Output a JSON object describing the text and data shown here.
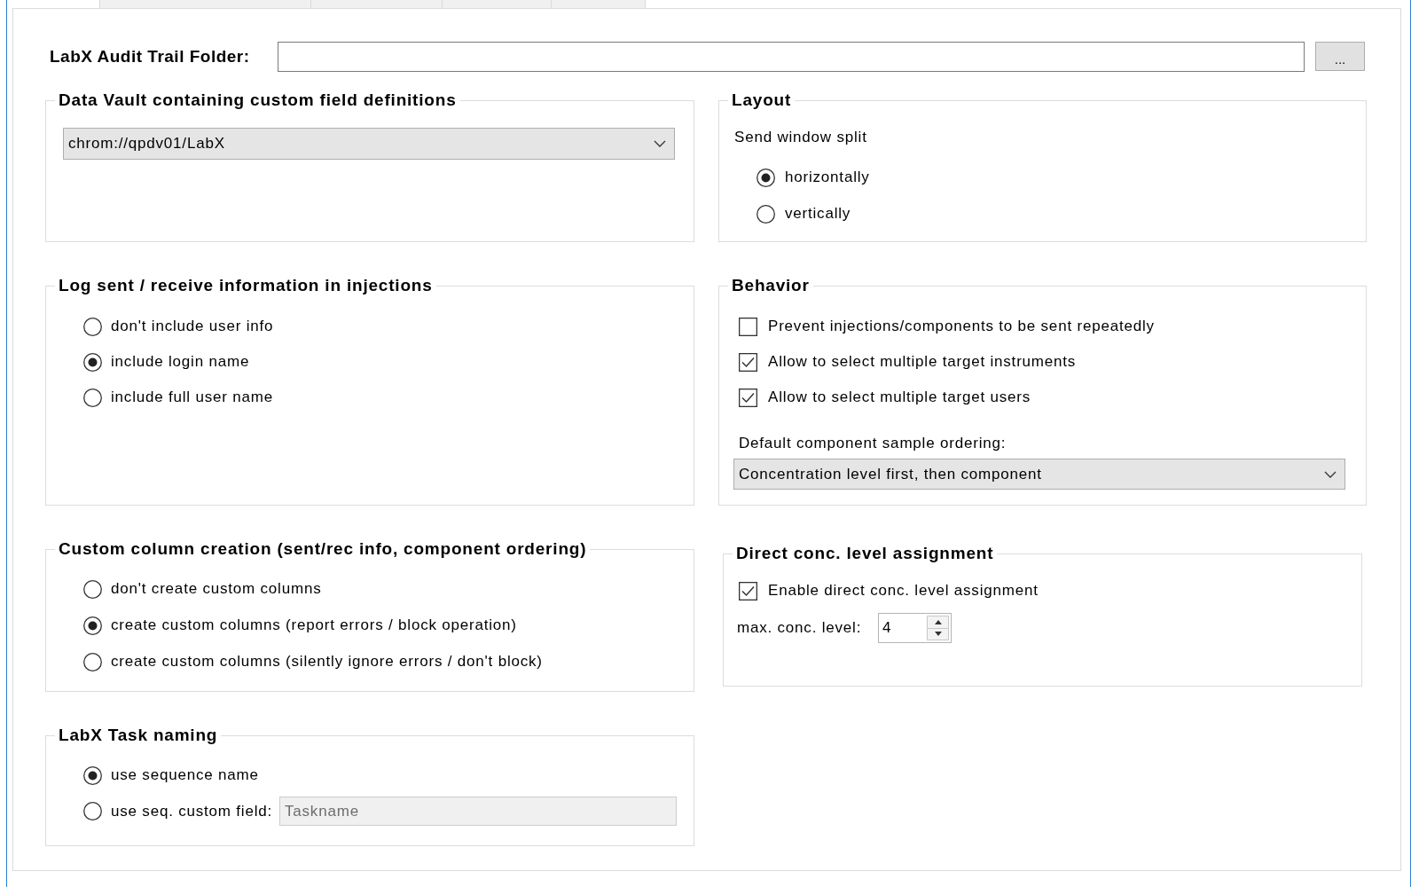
{
  "tabs": [
    {
      "selected": false
    },
    {
      "selected": false
    },
    {
      "selected": false
    },
    {
      "selected": false
    }
  ],
  "audit_folder": {
    "label": "LabX Audit Trail Folder:",
    "button": "..."
  },
  "data_vault": {
    "title": "Data Vault containing custom field definitions",
    "dropdown": {
      "value": "chrom://qpdv01/LabX"
    }
  },
  "layout": {
    "title": "Layout",
    "label": "Send window split",
    "options": [
      {
        "label": "horizontally",
        "selected": true
      },
      {
        "label": "vertically",
        "selected": false
      }
    ]
  },
  "log_info": {
    "title": "Log sent / receive information in injections",
    "options": [
      {
        "label": "don't include user info",
        "selected": false
      },
      {
        "label": "include login name",
        "selected": true
      },
      {
        "label": "include full user name",
        "selected": false
      }
    ]
  },
  "behavior": {
    "title": "Behavior",
    "checkboxes": [
      {
        "label": "Prevent injections/components to be sent repeatedly",
        "checked": false
      },
      {
        "label": "Allow to select multiple target instruments",
        "checked": true
      },
      {
        "label": "Allow to select multiple target users",
        "checked": true
      }
    ],
    "ordering": {
      "label": "Default component sample ordering:",
      "value": "Concentration level first, then component"
    }
  },
  "custom_columns": {
    "title": "Custom column creation (sent/rec info, component ordering)",
    "options": [
      {
        "label": "don't create custom columns",
        "selected": false
      },
      {
        "label": "create custom columns (report errors / block operation)",
        "selected": true
      },
      {
        "label": "create custom columns (silently ignore errors / don't block)",
        "selected": false
      }
    ]
  },
  "direct_conc": {
    "title": "Direct conc. level assignment",
    "checkbox": {
      "label": "Enable direct conc. level assignment",
      "checked": true
    },
    "max_level": {
      "label": "max. conc. level:",
      "value": "4"
    }
  },
  "task_naming": {
    "title": "LabX Task naming",
    "options": [
      {
        "label": "use sequence name",
        "selected": true
      },
      {
        "label": "use seq. custom field:",
        "selected": false,
        "field": {
          "value": "Taskname",
          "disabled": true
        }
      }
    ]
  }
}
